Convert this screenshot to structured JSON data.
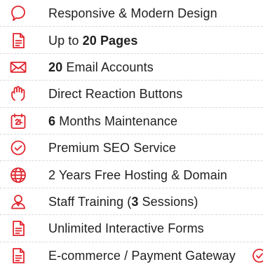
{
  "colors": {
    "accent": "#e0262e",
    "text": "#1f1f1f",
    "divider": "#d9d9d9"
  },
  "features": [
    {
      "icon": "responsive-design-icon",
      "parts": [
        "",
        "Responsive & Modern Design",
        ""
      ]
    },
    {
      "icon": "document-pages-icon",
      "parts": [
        "Up to ",
        "20 Pages",
        ""
      ]
    },
    {
      "icon": "email-envelope-icon",
      "parts": [
        "",
        "20",
        " Email Accounts"
      ]
    },
    {
      "icon": "reaction-hand-icon",
      "parts": [
        "",
        "",
        "Direct Reaction Buttons"
      ]
    },
    {
      "icon": "maintenance-calendar-icon",
      "parts": [
        "",
        "6",
        " Months Maintenance"
      ]
    },
    {
      "icon": "seo-check-icon",
      "parts": [
        "",
        "",
        "Premium SEO Service"
      ]
    },
    {
      "icon": "globe-hosting-icon",
      "parts": [
        "",
        "",
        "2 Years Free Hosting & Domain"
      ]
    },
    {
      "icon": "staff-user-icon",
      "parts": [
        "Staff Training (",
        "3",
        " Sessions)"
      ]
    },
    {
      "icon": "forms-document-icon",
      "parts": [
        "",
        "",
        "Unlimited Interactive Forms"
      ]
    },
    {
      "icon": "ecommerce-document-icon",
      "parts": [
        "",
        "",
        "E-commerce / Payment Gateway"
      ]
    }
  ]
}
